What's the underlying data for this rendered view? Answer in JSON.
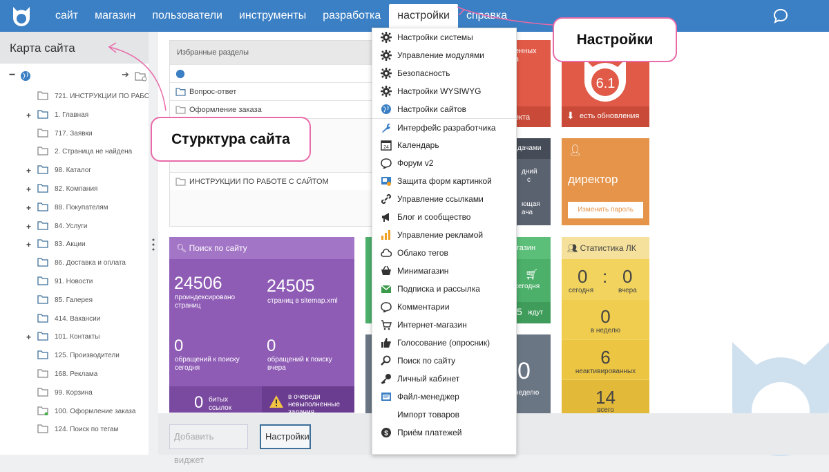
{
  "nav": [
    "сайт",
    "магазин",
    "пользователи",
    "инструменты",
    "разработка",
    "настройки",
    "справка"
  ],
  "sidebar": {
    "title": "Карта сайта",
    "items": [
      {
        "label": "721. ИНСТРУКЦИИ ПО РАБО",
        "plus": false
      },
      {
        "label": "1. Главная",
        "plus": true
      },
      {
        "label": "717. Заявки",
        "plus": false
      },
      {
        "label": "2. Страница не найдена",
        "plus": false
      },
      {
        "label": "98. Каталог",
        "plus": true
      },
      {
        "label": "82. Компания",
        "plus": true
      },
      {
        "label": "88. Покупателям",
        "plus": true
      },
      {
        "label": "84. Услуги",
        "plus": true
      },
      {
        "label": "83. Акции",
        "plus": true
      },
      {
        "label": "86. Доставка и оплата",
        "plus": false
      },
      {
        "label": "91. Новости",
        "plus": false
      },
      {
        "label": "85. Галерея",
        "plus": false
      },
      {
        "label": "414. Вакансии",
        "plus": false
      },
      {
        "label": "101. Контакты",
        "plus": true
      },
      {
        "label": "125. Производители",
        "plus": false
      },
      {
        "label": "168. Реклама",
        "plus": false
      },
      {
        "label": "99. Корзина",
        "plus": false
      },
      {
        "label": "100. Оформление заказа",
        "plus": false
      },
      {
        "label": "124. Поиск по тегам",
        "plus": false
      }
    ]
  },
  "favorites": {
    "title": "Избранные разделы",
    "rows": [
      "Вопрос-ответ",
      "Оформление заказа",
      "ИНСТРУКЦИИ ПО РАБОТЕ С САЙТОМ"
    ]
  },
  "tiles": {
    "red_partial_1": "енных",
    "red_partial_2": "в",
    "red_partial_3": "екта",
    "version": "6.1",
    "updates": "есть обновления",
    "dark_partial_1": "дачами",
    "dark_partial_2": "дний",
    "dark_partial_3": "с",
    "dark_partial_4": "ющая",
    "dark_partial_5": "ача",
    "role": "директор",
    "change_password": "Изменить пароль",
    "search_title": "Поиск по сайту",
    "indexed_num": "24506",
    "indexed_lbl": "проиндексировано страниц",
    "sitemap_num": "24505",
    "sitemap_lbl": "страниц в sitemap.xml",
    "today_num": "0",
    "today_lbl": "обращений к поиску сегодня",
    "yesterday_num": "0",
    "yesterday_lbl": "обращений к поиску вчера",
    "broken_num": "0",
    "broken_lbl": "битых ссылок",
    "queue_lbl": "в очереди невыполненные задания",
    "shop_partial": "газин",
    "shop_today": "сегодня",
    "shop_num": "5",
    "shop_wait": "ждут",
    "gray_num": "0",
    "gray_lbl": "неделю",
    "lk_title": "Статистика ЛК",
    "lk_today_num": "0",
    "lk_colon": ":",
    "lk_yesterday_num": "0",
    "lk_today": "сегодня",
    "lk_yesterday": "вчера",
    "lk_week_num": "0",
    "lk_week": "в неделю",
    "lk_inactive_num": "6",
    "lk_inactive": "неактивированных",
    "lk_total_num": "14",
    "lk_total": "всего"
  },
  "bottom": {
    "add_widget": "Добавить виджет",
    "settings": "Настройки"
  },
  "dropdown": [
    {
      "label": "Настройки системы",
      "icon": "gear-icon",
      "color": "#333"
    },
    {
      "label": "Управление модулями",
      "icon": "gear-icon",
      "color": "#333"
    },
    {
      "label": "Безопасность",
      "icon": "gear-icon",
      "color": "#333"
    },
    {
      "label": "Настройки WYSIWYG",
      "icon": "gear-icon",
      "color": "#333"
    },
    {
      "label": "Настройки сайтов",
      "icon": "globe-icon",
      "color": "#3b7fc4"
    },
    {
      "label": "Интерфейс разработчика",
      "icon": "wrench-icon",
      "color": "#3b7fc4"
    },
    {
      "label": "Календарь",
      "icon": "calendar-icon",
      "color": "#333"
    },
    {
      "label": "Форум v2",
      "icon": "speech-bubble-icon",
      "color": "#333"
    },
    {
      "label": "Защита форм картинкой",
      "icon": "captcha-icon",
      "color": "#3b7fc4"
    },
    {
      "label": "Управление ссылками",
      "icon": "link-icon",
      "color": "#333"
    },
    {
      "label": "Блог и сообщество",
      "icon": "megaphone-icon",
      "color": "#333"
    },
    {
      "label": "Управление рекламой",
      "icon": "bar-chart-icon",
      "color": "#f0a020"
    },
    {
      "label": "Облако тегов",
      "icon": "cloud-icon",
      "color": "#333"
    },
    {
      "label": "Минимагазин",
      "icon": "basket-icon",
      "color": "#333"
    },
    {
      "label": "Подписка и рассылка",
      "icon": "mail-icon",
      "color": "#3a9a4a"
    },
    {
      "label": "Комментарии",
      "icon": "comment-icon",
      "color": "#333"
    },
    {
      "label": "Интернет-магазин",
      "icon": "cart-icon",
      "color": "#333"
    },
    {
      "label": "Голосование (опросник)",
      "icon": "thumbs-up-icon",
      "color": "#333"
    },
    {
      "label": "Поиск по сайту",
      "icon": "magnifier-icon",
      "color": "#333"
    },
    {
      "label": "Личный кабинет",
      "icon": "key-icon",
      "color": "#333"
    },
    {
      "label": "Файл-менеджер",
      "icon": "file-manager-icon",
      "color": "#3b7fc4"
    },
    {
      "label": "Импорт товаров",
      "icon": "",
      "color": "#333"
    },
    {
      "label": "Приём платежей",
      "icon": "coin-icon",
      "color": "#333"
    }
  ],
  "callouts": {
    "settings": "Настройки",
    "structure": "Стурктура сайта"
  },
  "colors": {
    "accent": "#3b7fc4",
    "callout_border": "#e86aa8"
  }
}
